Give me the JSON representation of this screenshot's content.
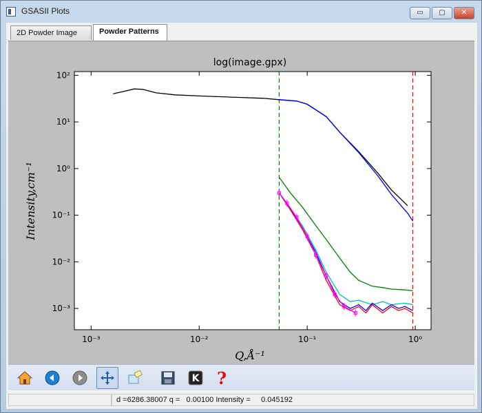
{
  "window": {
    "title": "GSASII Plots",
    "buttons": {
      "minimize": "▭",
      "maximize": "▢",
      "close": "✕"
    }
  },
  "tabs": [
    {
      "label": "2D Powder Image",
      "selected": false
    },
    {
      "label": "Powder Patterns",
      "selected": true
    }
  ],
  "chart_data": {
    "type": "line",
    "title": "log(image.gpx)",
    "xlabel": "Q,Å⁻¹",
    "ylabel": "Intensity,cm⁻¹",
    "xscale": "log",
    "yscale": "log",
    "xlim": [
      0.0007,
      1.4
    ],
    "ylim": [
      0.00035,
      120
    ],
    "x_ticks": [
      {
        "value": 0.001,
        "label": "10⁻³"
      },
      {
        "value": 0.01,
        "label": "10⁻²"
      },
      {
        "value": 0.1,
        "label": "10⁻¹"
      },
      {
        "value": 1,
        "label": "10⁰"
      }
    ],
    "y_ticks": [
      {
        "value": 0.001,
        "label": "10⁻³"
      },
      {
        "value": 0.01,
        "label": "10⁻²"
      },
      {
        "value": 0.1,
        "label": "10⁻¹"
      },
      {
        "value": 1,
        "label": "10⁰"
      },
      {
        "value": 10,
        "label": "10¹"
      },
      {
        "value": 100,
        "label": "10²"
      }
    ],
    "vlines": [
      {
        "x": 0.055,
        "color": "#008000",
        "style": "dashed"
      },
      {
        "x": 0.95,
        "color": "#ff0000",
        "style": "dashed"
      }
    ],
    "series": [
      {
        "color": "#000000",
        "x": [
          0.0016,
          0.002,
          0.0025,
          0.003,
          0.004,
          0.006,
          0.01,
          0.02,
          0.04,
          0.055,
          0.08,
          0.1,
          0.15,
          0.2,
          0.3,
          0.45,
          0.6,
          0.85
        ],
        "y": [
          40,
          45,
          51,
          50,
          42,
          38,
          36,
          34,
          32,
          30,
          28,
          24,
          13,
          6,
          2.3,
          0.8,
          0.35,
          0.16
        ]
      },
      {
        "color": "#0000ff",
        "x": [
          0.055,
          0.08,
          0.1,
          0.15,
          0.2,
          0.3,
          0.45,
          0.6,
          0.85,
          0.95
        ],
        "y": [
          30,
          28,
          24,
          13,
          6,
          2.2,
          0.7,
          0.28,
          0.11,
          0.075
        ]
      },
      {
        "color": "#008000",
        "x": [
          0.055,
          0.07,
          0.09,
          0.12,
          0.15,
          0.2,
          0.25,
          0.3,
          0.4,
          0.5,
          0.6,
          0.8,
          0.95
        ],
        "y": [
          0.65,
          0.3,
          0.15,
          0.06,
          0.03,
          0.012,
          0.006,
          0.004,
          0.003,
          0.0028,
          0.0026,
          0.0025,
          0.0024
        ]
      },
      {
        "color": "#00bfbf",
        "x": [
          0.055,
          0.07,
          0.09,
          0.12,
          0.15,
          0.2,
          0.25,
          0.3,
          0.4,
          0.5,
          0.6,
          0.8,
          0.95
        ],
        "y": [
          0.3,
          0.14,
          0.06,
          0.018,
          0.006,
          0.002,
          0.0014,
          0.0015,
          0.0012,
          0.0014,
          0.0012,
          0.0013,
          0.0012
        ]
      },
      {
        "color": "#ff0000",
        "x": [
          0.055,
          0.07,
          0.09,
          0.12,
          0.15,
          0.2,
          0.25,
          0.3,
          0.35,
          0.4,
          0.5,
          0.6,
          0.7,
          0.8,
          0.95
        ],
        "y": [
          0.3,
          0.13,
          0.05,
          0.014,
          0.004,
          0.0012,
          0.0009,
          0.0011,
          0.0008,
          0.0012,
          0.0008,
          0.0011,
          0.0009,
          0.001,
          0.0008
        ]
      },
      {
        "color": "#0000ff",
        "x": [
          0.055,
          0.07,
          0.09,
          0.12,
          0.15,
          0.2,
          0.25,
          0.3,
          0.35,
          0.4,
          0.5,
          0.6,
          0.7,
          0.8,
          0.95
        ],
        "y": [
          0.3,
          0.14,
          0.055,
          0.016,
          0.005,
          0.0014,
          0.001,
          0.0012,
          0.0009,
          0.0013,
          0.0009,
          0.0012,
          0.001,
          0.0011,
          0.0009
        ]
      },
      {
        "color": "#ff00ff",
        "markers": "errorbar",
        "x": [
          0.055,
          0.065,
          0.08,
          0.1,
          0.12,
          0.15,
          0.18,
          0.22,
          0.28
        ],
        "y": [
          0.3,
          0.18,
          0.09,
          0.035,
          0.014,
          0.005,
          0.002,
          0.0011,
          0.0008
        ]
      }
    ]
  },
  "toolbar": {
    "buttons": [
      {
        "name": "home-icon"
      },
      {
        "name": "back-icon"
      },
      {
        "name": "forward-icon"
      },
      {
        "name": "pan-icon",
        "active": true
      },
      {
        "name": "zoom-icon"
      },
      {
        "name": "save-icon"
      },
      {
        "name": "key-icon"
      },
      {
        "name": "help-icon"
      }
    ]
  },
  "status": {
    "readout": "d =6286.38007 q =   0.00100 Intensity =     0.045192"
  }
}
